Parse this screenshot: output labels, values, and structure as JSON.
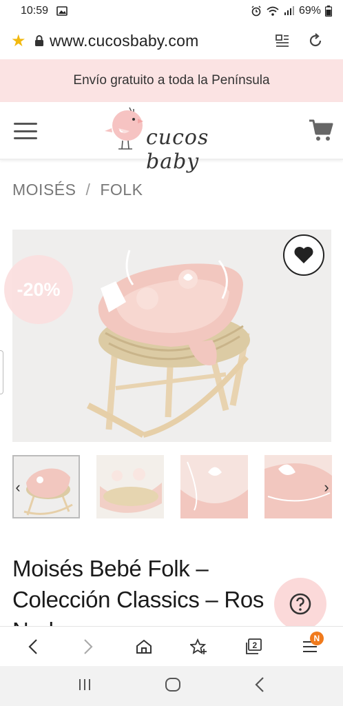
{
  "status_bar": {
    "time": "10:59",
    "battery": "69%"
  },
  "browser": {
    "url": "www.cucosbaby.com"
  },
  "promo": {
    "text": "Envío gratuito a toda la Península"
  },
  "header": {
    "logo_text": "cucos baby"
  },
  "breadcrumb": {
    "items": [
      "MOISÉS",
      "FOLK"
    ],
    "separator": "/"
  },
  "product": {
    "discount": "-20%",
    "title_line1": "Moisés Bebé Folk –",
    "title_line2": "Colección Classics – Ros",
    "title_line3": "Nude"
  },
  "browser_nav": {
    "tabs_count": "2",
    "menu_badge": "N"
  },
  "colors": {
    "promo_bg": "#fbe3e3",
    "accent_pink": "#f3c6c2",
    "star": "#f2b90f",
    "badge_orange": "#f07a1c"
  },
  "icons": [
    "image-icon",
    "alarm-icon",
    "wifi-icon",
    "signal-icon",
    "battery-icon",
    "star-icon",
    "lock-icon",
    "reader-mode-icon",
    "reload-icon",
    "hamburger-icon",
    "cart-icon",
    "heart-icon",
    "chevron-left-icon",
    "chevron-right-icon",
    "question-icon",
    "back-icon",
    "forward-icon",
    "home-icon",
    "bookmark-add-icon",
    "tabs-icon",
    "menu-icon",
    "recents-icon",
    "home-circle-icon"
  ]
}
